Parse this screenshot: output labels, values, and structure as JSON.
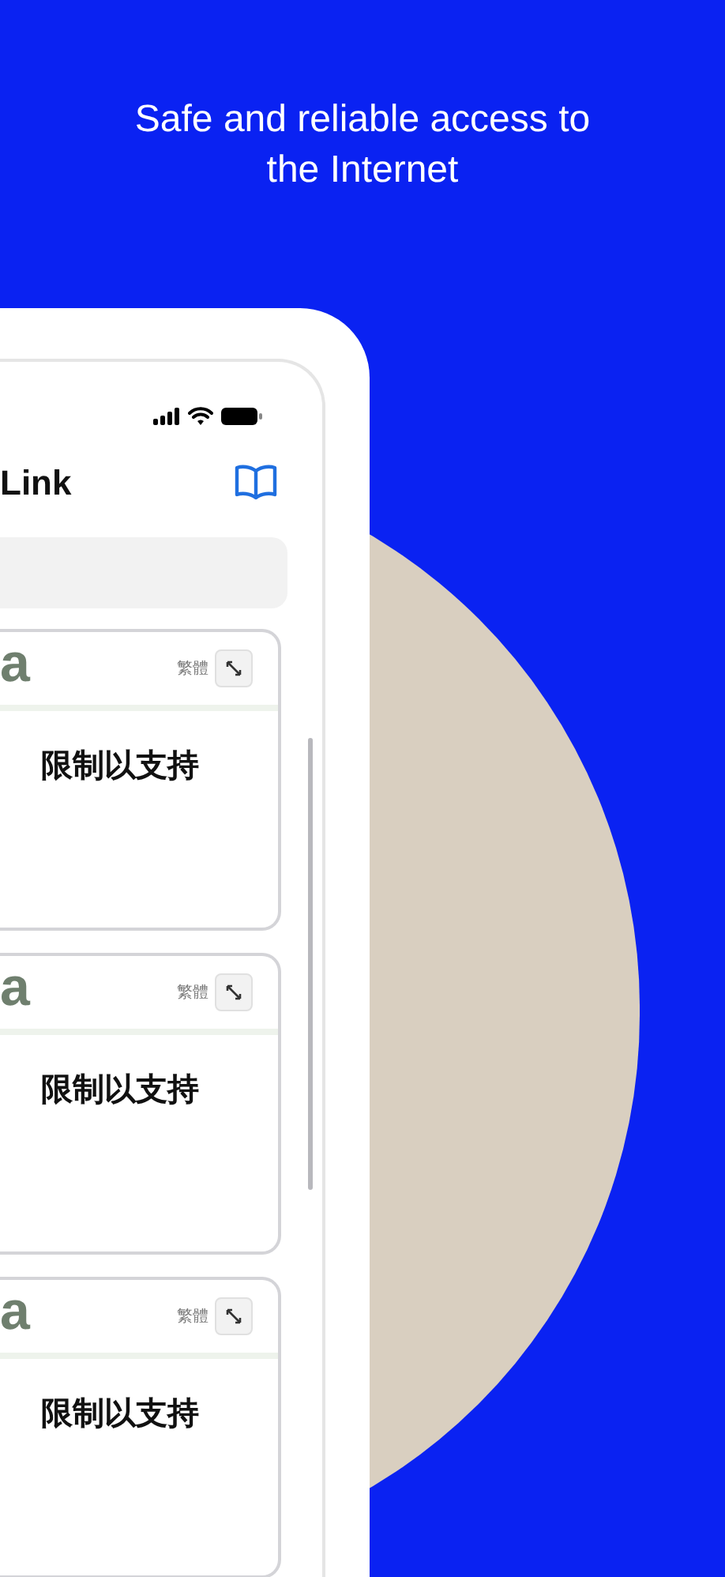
{
  "headline": "Safe and reliable access to the Internet",
  "app": {
    "title": "Link"
  },
  "cards": [
    {
      "logo": "a",
      "language": "繁體",
      "text": "限制以支持"
    },
    {
      "logo": "a",
      "language": "繁體",
      "text": "限制以支持"
    },
    {
      "logo": "a",
      "language": "繁體",
      "text": "限制以支持"
    }
  ]
}
